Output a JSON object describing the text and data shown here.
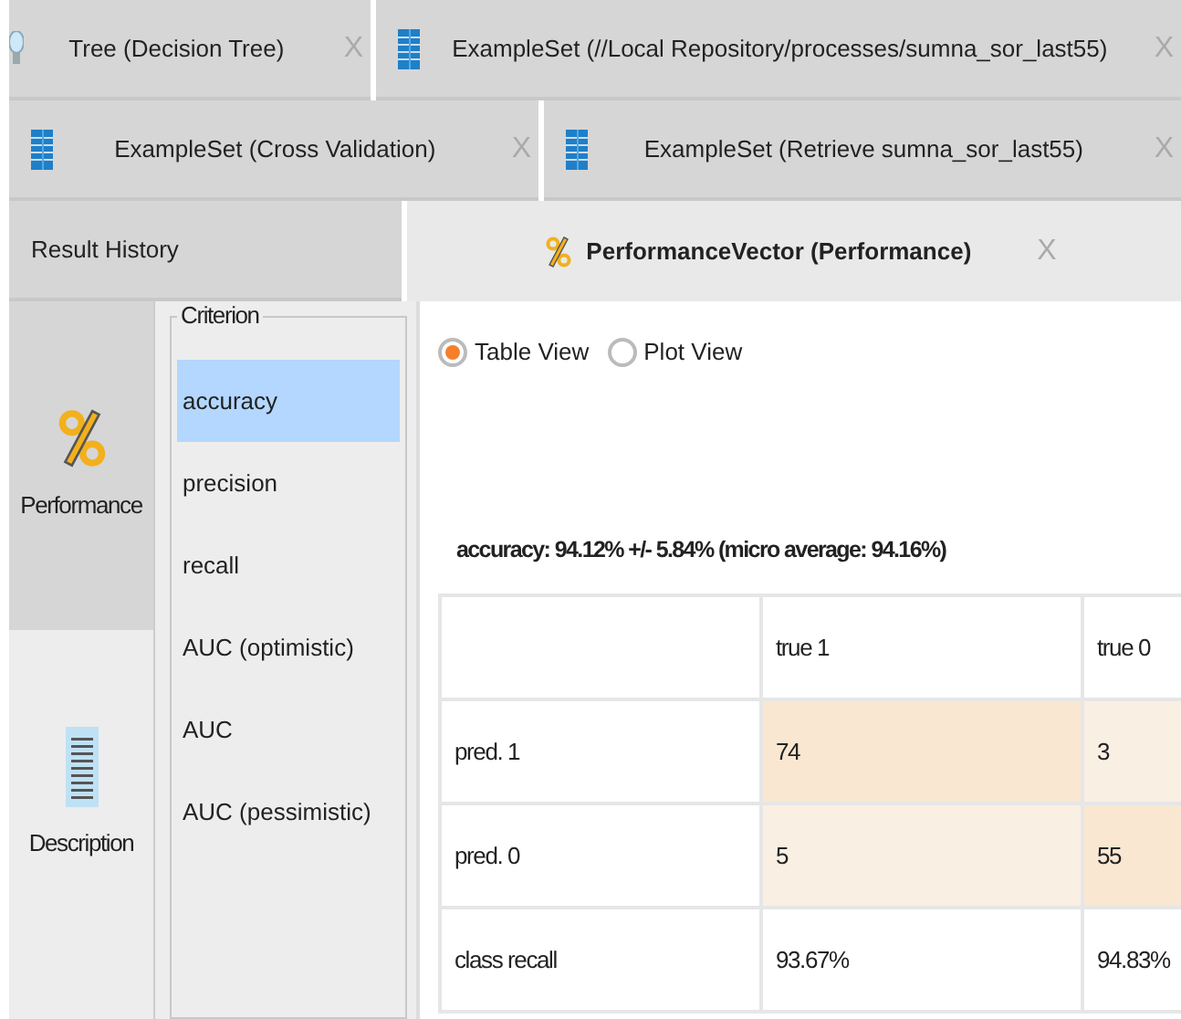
{
  "tab_rows": [
    {
      "tabs": [
        {
          "label": "Tree (Decision Tree)",
          "kind": "bulb",
          "close": "X",
          "selected": false
        },
        {
          "label": "ExampleSet (//Local Repository/processes/sumna_sor_last55)",
          "kind": "table",
          "close": "X",
          "selected": false
        }
      ]
    },
    {
      "tabs": [
        {
          "label": "ExampleSet (Cross Validation)",
          "kind": "table",
          "close": "X",
          "selected": false
        },
        {
          "label": "ExampleSet (Retrieve sumna_sor_last55)",
          "kind": "table",
          "close": "X",
          "selected": false
        }
      ]
    },
    {
      "tabs": [
        {
          "label": "Result History",
          "selected": false
        },
        {
          "label": "PerformanceVector (Performance)",
          "kind": "percent",
          "close": "X",
          "selected": true
        }
      ]
    }
  ],
  "side_views": [
    {
      "label": "Performance",
      "kind": "percent",
      "selected": true
    },
    {
      "label": "Description",
      "kind": "document",
      "selected": false
    }
  ],
  "criterion": {
    "legend": "Criterion",
    "items": [
      {
        "label": "accuracy",
        "selected": true
      },
      {
        "label": "precision",
        "selected": false
      },
      {
        "label": "recall",
        "selected": false
      },
      {
        "label": "AUC (optimistic)",
        "selected": false
      },
      {
        "label": "AUC",
        "selected": false
      },
      {
        "label": "AUC (pessimistic)",
        "selected": false
      }
    ]
  },
  "view_options": [
    {
      "label": "Table View",
      "selected": true
    },
    {
      "label": "Plot View",
      "selected": false
    }
  ],
  "summary": "accuracy: 94.12% +/- 5.84% (micro average: 94.16%)",
  "table": {
    "columns": [
      "true 1",
      "true 0"
    ],
    "rows": [
      {
        "label": "pred. 1",
        "cells": [
          {
            "value": "74",
            "emphasized": true
          },
          {
            "value": "3",
            "emphasized": false
          }
        ]
      },
      {
        "label": "pred. 0",
        "cells": [
          {
            "value": "5",
            "emphasized": false
          },
          {
            "value": "55",
            "emphasized": true
          }
        ]
      },
      {
        "label": "class recall",
        "cells": [
          {
            "value": "93.67%"
          },
          {
            "value": "94.83%"
          }
        ]
      }
    ]
  }
}
